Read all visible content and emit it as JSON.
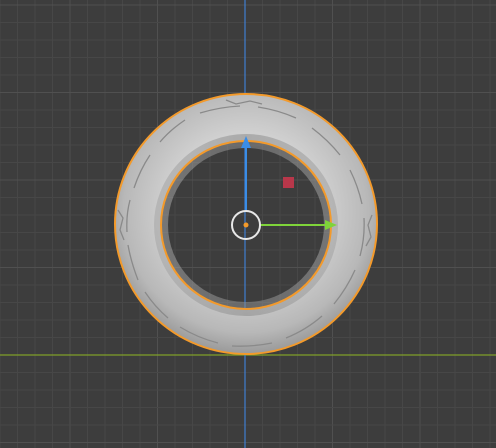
{
  "viewport": {
    "background_color": "#3d3d3d",
    "grid_minor_color": "#474747",
    "grid_major_color": "#505050",
    "x_axis_color": "#7f9f2a",
    "y_axis_color": "#3f7fd0"
  },
  "tire": {
    "outline_color": "#f39a2b",
    "body_color": "#b9b9b9",
    "inner_shade_color": "#8f8f8f"
  },
  "gizmo": {
    "x_arrow_color": "#7fd43a",
    "y_arrow_color": "#3a8de6",
    "plane_handle_color": "#b8374a",
    "center_ring_color": "#e8e8e8",
    "origin_color": "#f39a2b"
  }
}
